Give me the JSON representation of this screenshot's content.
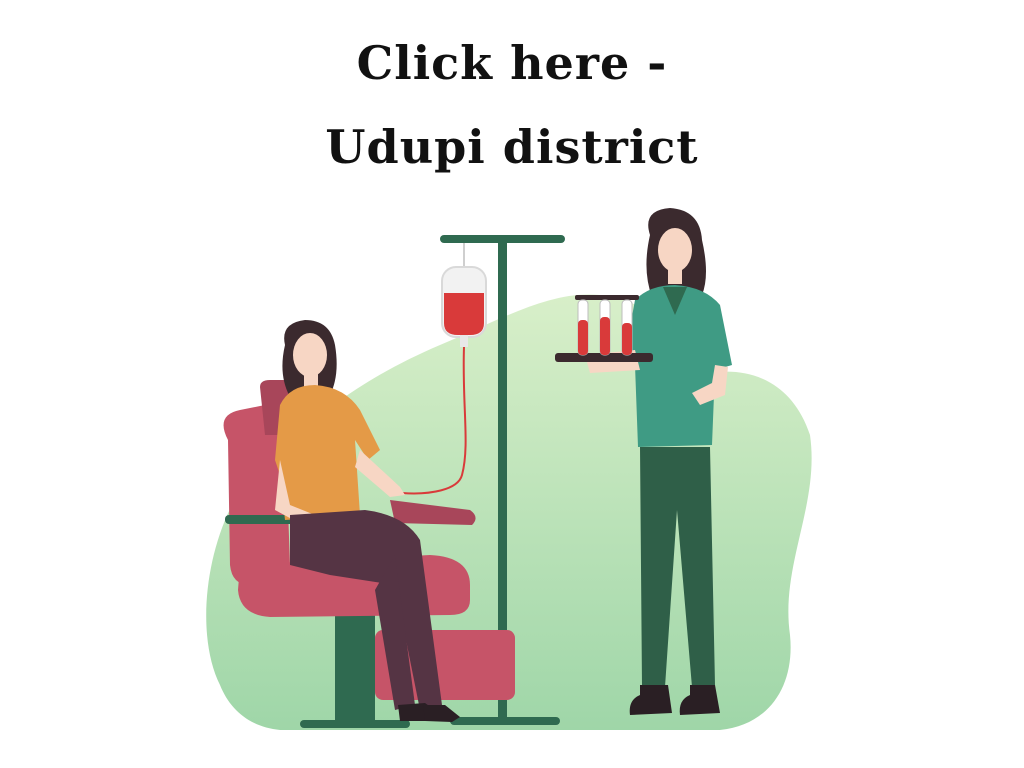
{
  "heading": {
    "line1": "Click here  -",
    "line2": "Udupi district"
  },
  "illustration": {
    "subject": "blood donation",
    "colors": {
      "blob": "#bfe3b0",
      "chair": "#c65468",
      "stand": "#2f6a50",
      "blood": "#d93a3a",
      "donor_top": "#e49a47",
      "donor_pants": "#553444",
      "nurse_top": "#3f9b84",
      "nurse_pants": "#2f5f48",
      "hair": "#3b2a2e",
      "skin": "#f7d6c4"
    }
  }
}
